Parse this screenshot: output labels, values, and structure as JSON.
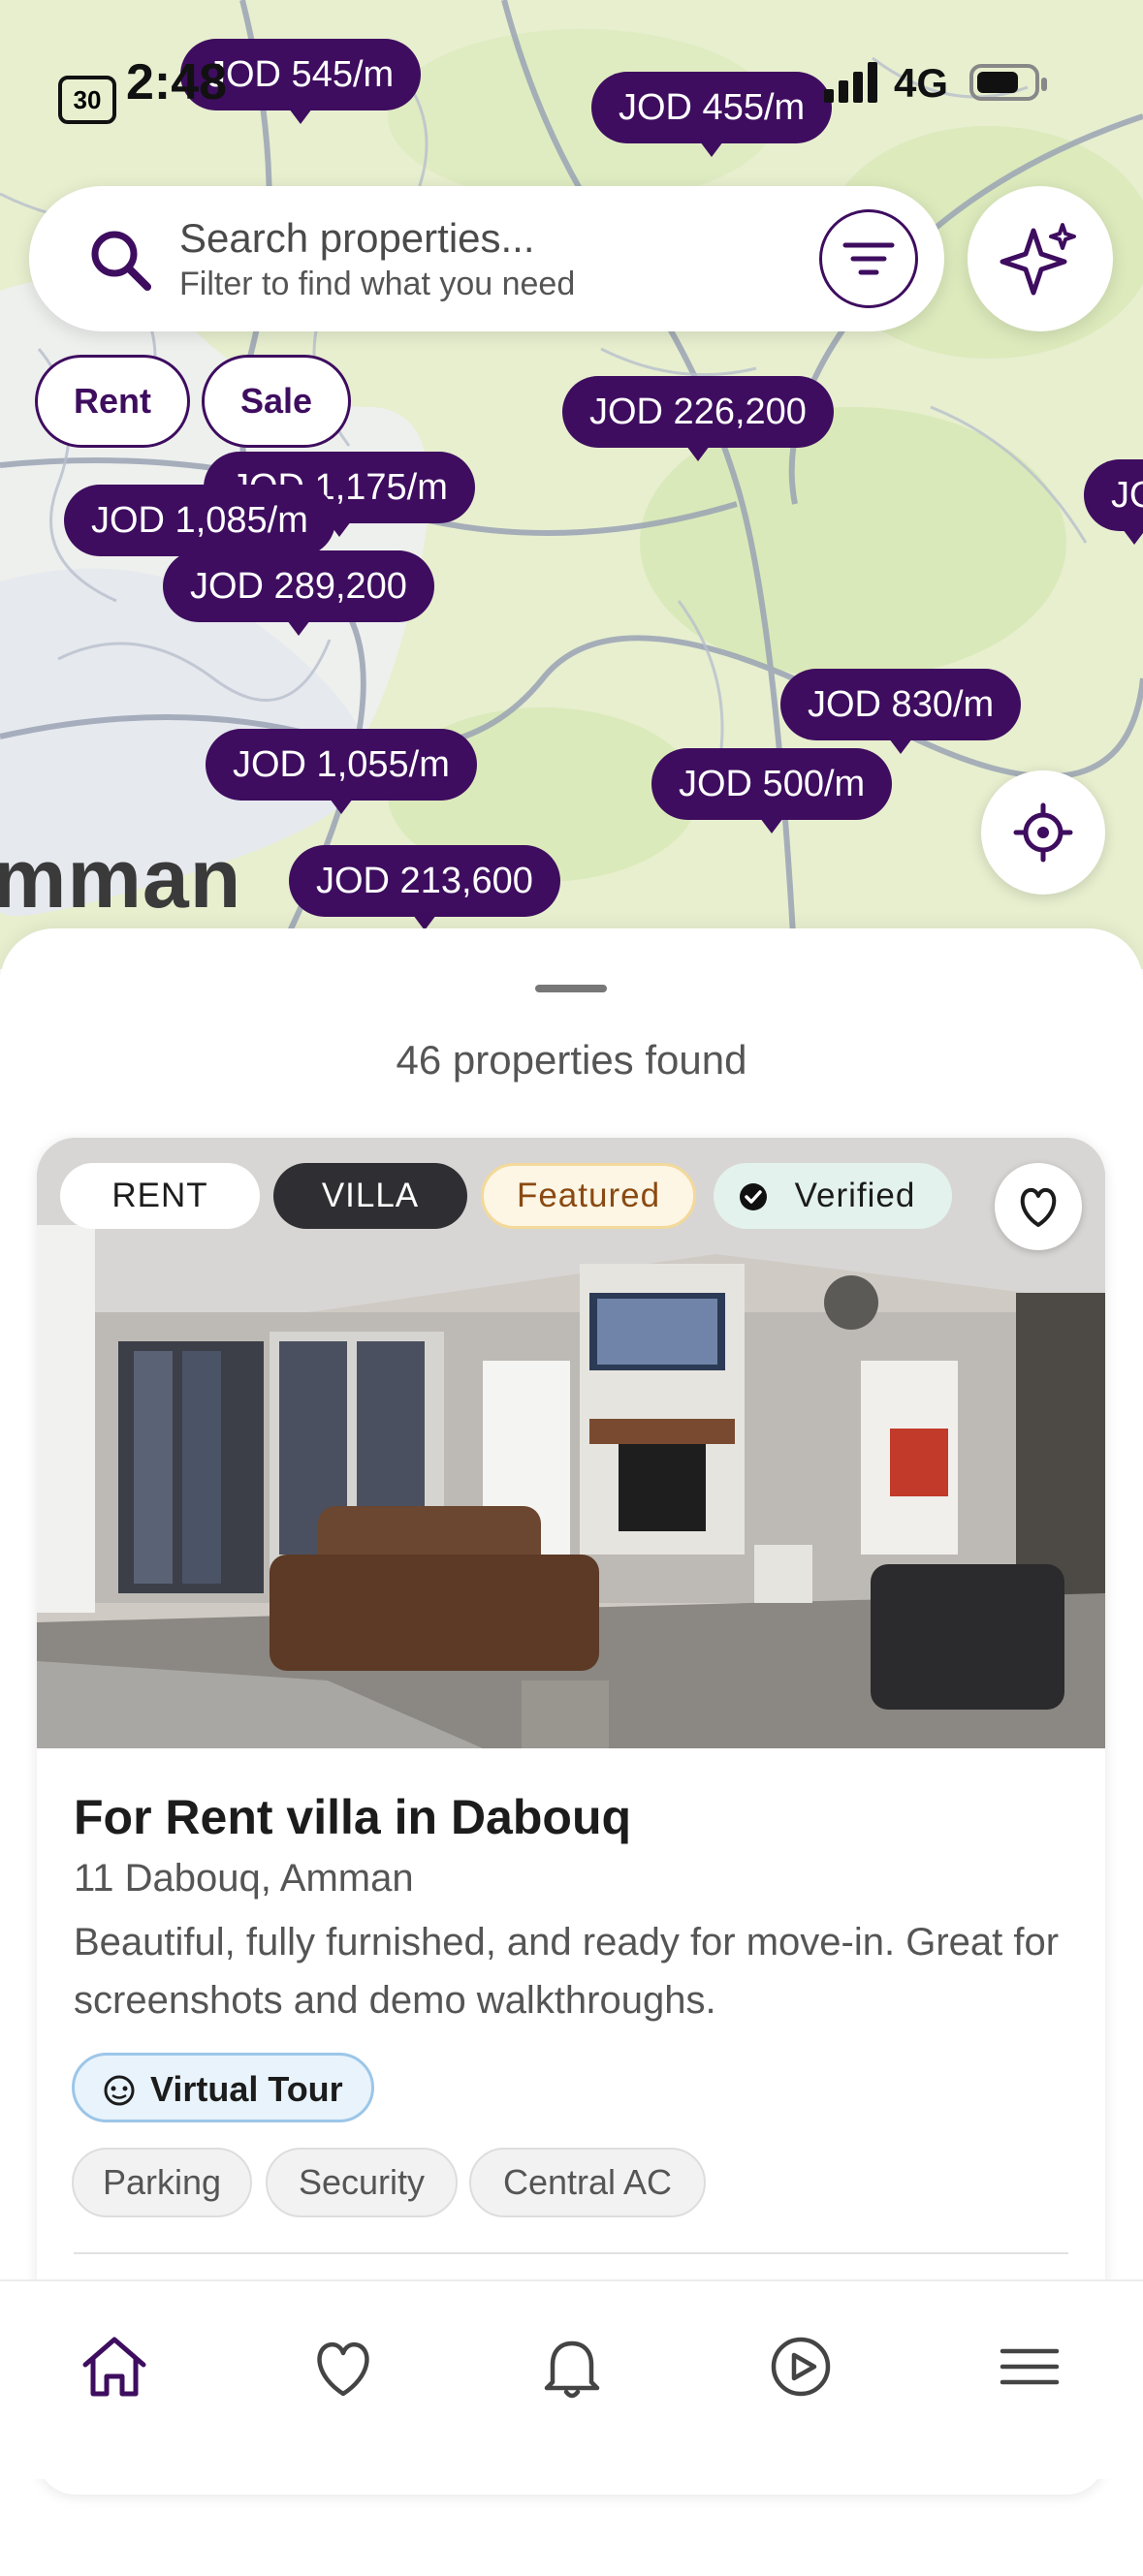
{
  "status_bar": {
    "battery_percent": "30",
    "time": "2:48",
    "network": "4G"
  },
  "map": {
    "city_label": "mman",
    "price_pins": [
      "JOD 545/m",
      "JOD 455/m",
      "JOD 226,200",
      "JOD 1,175/m",
      "JOD 1,085/m",
      "JOD 289,200",
      "JOD 830/m",
      "JOD 1,055/m",
      "JOD 500/m",
      "JOD 213,600",
      "JO"
    ]
  },
  "search": {
    "placeholder": "Search properties...",
    "subtitle": "Filter to find what you need"
  },
  "filters": {
    "rent_label": "Rent",
    "sale_label": "Sale"
  },
  "results": {
    "count_text": "46 properties found"
  },
  "listing": {
    "badges": {
      "type": "RENT",
      "category": "VILLA",
      "featured": "Featured",
      "verified": "Verified"
    },
    "title": "For Rent villa in Dabouq",
    "address": "11 Dabouq, Amman",
    "description": "Beautiful, fully furnished, and ready for move-in. Great for screenshots and demo walkthroughs.",
    "virtual_tour_label": "Virtual Tour",
    "amenities": [
      "Parking",
      "Security",
      "Central AC"
    ]
  },
  "bottom_nav": {
    "icons": [
      "home-icon",
      "heart-icon",
      "bell-icon",
      "play-circle-icon",
      "menu-icon"
    ]
  },
  "colors": {
    "brand": "#3e0d5f",
    "map_bg": "#e7efcf",
    "featured_border": "#f3d99a",
    "verified_bg": "#e3f2ec"
  }
}
